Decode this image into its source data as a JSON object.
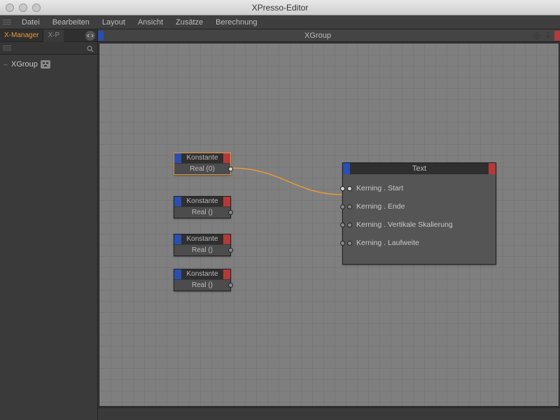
{
  "window": {
    "title": "XPresso-Editor"
  },
  "menu": [
    "Datei",
    "Bearbeiten",
    "Layout",
    "Ansicht",
    "Zusätze",
    "Berechnung"
  ],
  "sidebar": {
    "tabs": [
      "X-Manager",
      "X-P"
    ],
    "tree": [
      {
        "label": "XGroup"
      }
    ]
  },
  "canvas": {
    "title": "XGroup",
    "nodes": {
      "konst": [
        {
          "title": "Konstante",
          "value": "Real (0)",
          "selected": true
        },
        {
          "title": "Konstante",
          "value": "Real ()",
          "selected": false
        },
        {
          "title": "Konstante",
          "value": "Real ()",
          "selected": false
        },
        {
          "title": "Konstante",
          "value": "Real ()",
          "selected": false
        }
      ],
      "text": {
        "title": "Text",
        "inputs": [
          "Kerning . Start",
          "Kerning . Ende",
          "Kerning . Vertikale Skalierung",
          "Kerning . Laufweite"
        ]
      }
    }
  }
}
